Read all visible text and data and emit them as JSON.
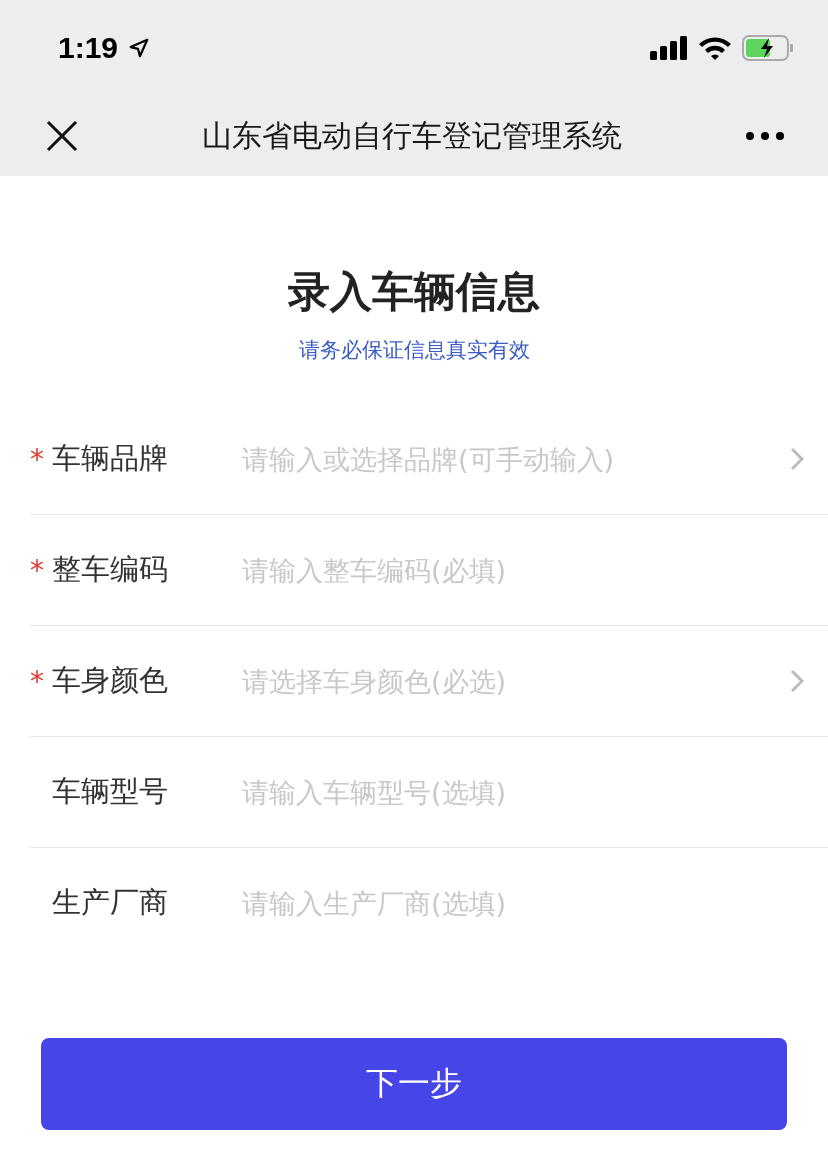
{
  "status_bar": {
    "time": "1:19"
  },
  "nav_bar": {
    "title": "山东省电动自行车登记管理系统"
  },
  "header": {
    "title": "录入车辆信息",
    "subtitle": "请务必保证信息真实有效"
  },
  "fields": [
    {
      "label": "车辆品牌",
      "placeholder": "请输入或选择品牌(可手动输入)",
      "required_mark": "*",
      "kind": "select"
    },
    {
      "label": "整车编码",
      "placeholder": "请输入整车编码(必填)",
      "required_mark": "*",
      "kind": "input"
    },
    {
      "label": "车身颜色",
      "placeholder": "请选择车身颜色(必选)",
      "required_mark": "*",
      "kind": "select"
    },
    {
      "label": "车辆型号",
      "placeholder": "请输入车辆型号(选填)",
      "kind": "input"
    },
    {
      "label": "生产厂商",
      "placeholder": "请输入生产厂商(选填)",
      "kind": "input"
    }
  ],
  "next_button": "下一步"
}
